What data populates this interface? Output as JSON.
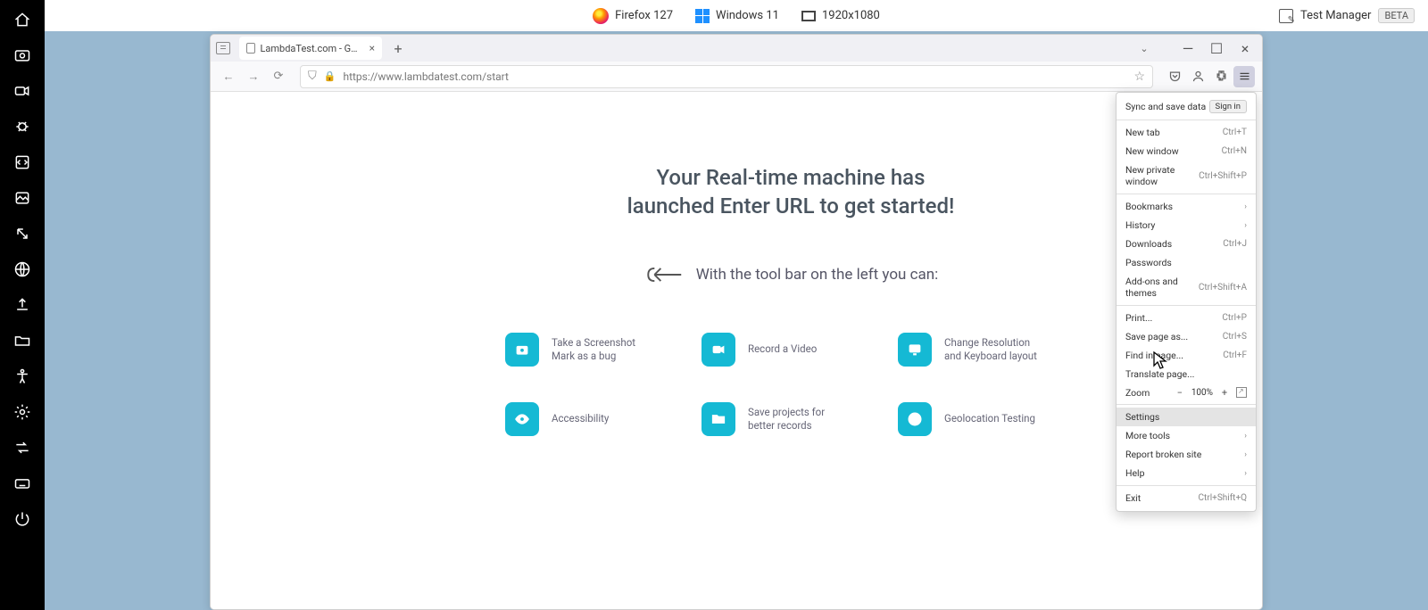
{
  "info_bar": {
    "browser": "Firefox 127",
    "os": "Windows 11",
    "resolution": "1920x1080",
    "test_manager_label": "Test Manager",
    "beta": "BETA"
  },
  "tab": {
    "title": "LambdaTest.com - Get Started"
  },
  "url": "https://www.lambdatest.com/start",
  "page": {
    "headline_line1": "Your Real-time machine has",
    "headline_line2": "launched Enter URL to get started!",
    "toolbar_hint": "With the tool bar on the left you can:",
    "features": [
      {
        "line1": "Take a Screenshot",
        "line2": "Mark as a bug"
      },
      {
        "line1": "Record a Video",
        "line2": ""
      },
      {
        "line1": "Change Resolution",
        "line2": "and Keyboard layout"
      },
      {
        "line1": "Accessibility",
        "line2": ""
      },
      {
        "line1": "Save projects for",
        "line2": "better records"
      },
      {
        "line1": "Geolocation Testing",
        "line2": ""
      }
    ]
  },
  "menu": {
    "sync_label": "Sync and save data",
    "signin": "Sign in",
    "items_a": [
      {
        "label": "New tab",
        "shortcut": "Ctrl+T"
      },
      {
        "label": "New window",
        "shortcut": "Ctrl+N"
      },
      {
        "label": "New private window",
        "shortcut": "Ctrl+Shift+P"
      }
    ],
    "items_b": [
      {
        "label": "Bookmarks",
        "shortcut": "",
        "submenu": true
      },
      {
        "label": "History",
        "shortcut": "",
        "submenu": true
      },
      {
        "label": "Downloads",
        "shortcut": "Ctrl+J"
      },
      {
        "label": "Passwords",
        "shortcut": ""
      },
      {
        "label": "Add-ons and themes",
        "shortcut": "Ctrl+Shift+A"
      }
    ],
    "items_c": [
      {
        "label": "Print...",
        "shortcut": "Ctrl+P"
      },
      {
        "label": "Save page as...",
        "shortcut": "Ctrl+S"
      },
      {
        "label": "Find in page...",
        "shortcut": "Ctrl+F"
      },
      {
        "label": "Translate page...",
        "shortcut": ""
      }
    ],
    "zoom_label": "Zoom",
    "zoom_value": "100%",
    "items_d": [
      {
        "label": "Settings",
        "shortcut": "",
        "highlighted": true
      },
      {
        "label": "More tools",
        "shortcut": "",
        "submenu": true
      },
      {
        "label": "Report broken site",
        "shortcut": "",
        "submenu": true
      },
      {
        "label": "Help",
        "shortcut": "",
        "submenu": true
      }
    ],
    "exit": {
      "label": "Exit",
      "shortcut": "Ctrl+Shift+Q"
    }
  }
}
